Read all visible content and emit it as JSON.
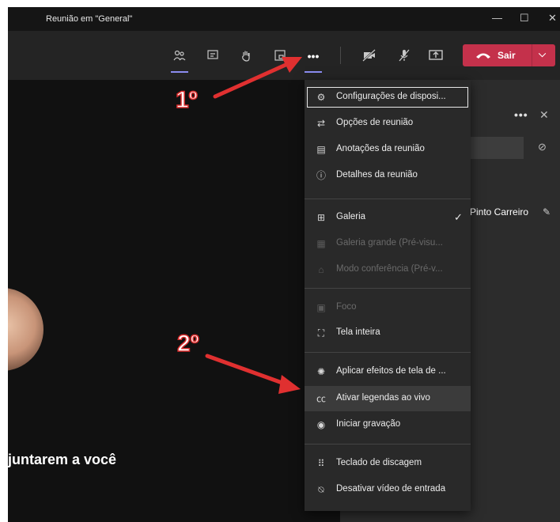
{
  "window": {
    "title": "Reunião em \"General\"",
    "minimize": "—",
    "maximize": "☐",
    "close": "✕"
  },
  "toolbar": {
    "participants_icon": "people-icon",
    "chat_icon": "chat-icon",
    "raise_hand_icon": "hand-icon",
    "rooms_icon": "rooms-icon",
    "more_label": "•••",
    "camera_icon": "camera-off-icon",
    "mic_icon": "mic-off-icon",
    "share_icon": "share-icon",
    "leave_label": "Sair",
    "leave_chevron": "⌵",
    "accent": "#c4314b"
  },
  "menu": {
    "items": [
      {
        "label": "Configurações de disposi...",
        "icon": "⚙"
      },
      {
        "label": "Opções de reunião",
        "icon": "⇄"
      },
      {
        "label": "Anotações da reunião",
        "icon": "▤"
      },
      {
        "label": "Detalhes da reunião",
        "icon": "ⓘ"
      },
      {
        "label": "Galeria",
        "icon": "⊞",
        "checked": "✓"
      },
      {
        "label": "Galeria grande (Pré-visu...",
        "icon": "▦"
      },
      {
        "label": "Modo conferência (Pré-v...",
        "icon": "⌂"
      },
      {
        "label": "Foco",
        "icon": "▣"
      },
      {
        "label": "Tela inteira",
        "icon": "⛶"
      },
      {
        "label": "Aplicar efeitos de tela de ...",
        "icon": "✺"
      },
      {
        "label": "Ativar legendas ao vivo",
        "icon": "㏄"
      },
      {
        "label": "Iniciar gravação",
        "icon": "◉"
      },
      {
        "label": "Teclado de discagem",
        "icon": "⠿"
      },
      {
        "label": "Desativar vídeo de entrada",
        "icon": "⍉"
      }
    ]
  },
  "panel": {
    "more": "•••",
    "close": "✕",
    "participant_name": "Pinto Carreiro",
    "link_icon": "⊘",
    "mic_icon": "✎"
  },
  "stage": {
    "text": "juntarem a você"
  },
  "annotations": {
    "first": "1º",
    "second": "2º"
  }
}
